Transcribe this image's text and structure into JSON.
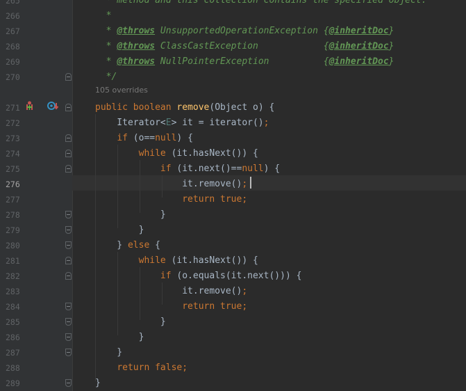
{
  "editor": {
    "lines": [
      {
        "num": "265",
        "tokens": [
          {
            "t": "  * method and this collection contains the specified object.",
            "c": "cmt"
          }
        ]
      },
      {
        "num": "266",
        "tokens": [
          {
            "t": "  *",
            "c": "cmt"
          }
        ]
      },
      {
        "num": "267",
        "tokens": [
          {
            "t": "  * ",
            "c": "cmt"
          },
          {
            "t": "@throws",
            "c": "tag"
          },
          {
            "t": " UnsupportedOperationException ",
            "c": "cmt"
          },
          {
            "t": "{",
            "c": "brace"
          },
          {
            "t": "@inheritDoc",
            "c": "inherit"
          },
          {
            "t": "}",
            "c": "brace"
          }
        ]
      },
      {
        "num": "268",
        "tokens": [
          {
            "t": "  * ",
            "c": "cmt"
          },
          {
            "t": "@throws",
            "c": "tag"
          },
          {
            "t": " ClassCastException            ",
            "c": "cmt"
          },
          {
            "t": "{",
            "c": "brace"
          },
          {
            "t": "@inheritDoc",
            "c": "inherit"
          },
          {
            "t": "}",
            "c": "brace"
          }
        ]
      },
      {
        "num": "269",
        "tokens": [
          {
            "t": "  * ",
            "c": "cmt"
          },
          {
            "t": "@throws",
            "c": "tag"
          },
          {
            "t": " NullPointerException          ",
            "c": "cmt"
          },
          {
            "t": "{",
            "c": "brace"
          },
          {
            "t": "@inheritDoc",
            "c": "inherit"
          },
          {
            "t": "}",
            "c": "brace"
          }
        ]
      },
      {
        "num": "270",
        "tokens": [
          {
            "t": "  */",
            "c": "cmt"
          }
        ]
      },
      {
        "num": "",
        "tokens": []
      },
      {
        "num": "271",
        "tokens": [
          {
            "t": "public boolean ",
            "c": "kw"
          },
          {
            "t": "remove",
            "c": "fn"
          },
          {
            "t": "(Object o) {",
            "c": ""
          }
        ]
      },
      {
        "num": "272",
        "tokens": [
          {
            "t": "    Iterator<",
            "c": ""
          },
          {
            "t": "E",
            "c": "generic"
          },
          {
            "t": "> it = iterator()",
            "c": ""
          },
          {
            "t": ";",
            "c": "kw"
          }
        ]
      },
      {
        "num": "273",
        "tokens": [
          {
            "t": "    ",
            "c": ""
          },
          {
            "t": "if",
            "c": "kw"
          },
          {
            "t": " (o==",
            "c": ""
          },
          {
            "t": "null",
            "c": "kw"
          },
          {
            "t": ") {",
            "c": ""
          }
        ]
      },
      {
        "num": "274",
        "tokens": [
          {
            "t": "        ",
            "c": ""
          },
          {
            "t": "while",
            "c": "kw"
          },
          {
            "t": " (it.hasNext()) {",
            "c": ""
          }
        ]
      },
      {
        "num": "275",
        "tokens": [
          {
            "t": "            ",
            "c": ""
          },
          {
            "t": "if",
            "c": "kw"
          },
          {
            "t": " (it.next()==",
            "c": ""
          },
          {
            "t": "null",
            "c": "kw"
          },
          {
            "t": ") {",
            "c": ""
          }
        ]
      },
      {
        "num": "276",
        "tokens": [
          {
            "t": "                it.remove()",
            "c": ""
          },
          {
            "t": ";",
            "c": "kw"
          }
        ]
      },
      {
        "num": "277",
        "tokens": [
          {
            "t": "                ",
            "c": ""
          },
          {
            "t": "return true;",
            "c": "kw"
          }
        ]
      },
      {
        "num": "278",
        "tokens": [
          {
            "t": "            }",
            "c": ""
          }
        ]
      },
      {
        "num": "279",
        "tokens": [
          {
            "t": "        }",
            "c": ""
          }
        ]
      },
      {
        "num": "280",
        "tokens": [
          {
            "t": "    } ",
            "c": ""
          },
          {
            "t": "else",
            "c": "kw"
          },
          {
            "t": " {",
            "c": ""
          }
        ]
      },
      {
        "num": "281",
        "tokens": [
          {
            "t": "        ",
            "c": ""
          },
          {
            "t": "while",
            "c": "kw"
          },
          {
            "t": " (it.hasNext()) {",
            "c": ""
          }
        ]
      },
      {
        "num": "282",
        "tokens": [
          {
            "t": "            ",
            "c": ""
          },
          {
            "t": "if",
            "c": "kw"
          },
          {
            "t": " (o.equals(it.next())) {",
            "c": ""
          }
        ]
      },
      {
        "num": "283",
        "tokens": [
          {
            "t": "                it.remove()",
            "c": ""
          },
          {
            "t": ";",
            "c": "kw"
          }
        ]
      },
      {
        "num": "284",
        "tokens": [
          {
            "t": "                ",
            "c": ""
          },
          {
            "t": "return true;",
            "c": "kw"
          }
        ]
      },
      {
        "num": "285",
        "tokens": [
          {
            "t": "            }",
            "c": ""
          }
        ]
      },
      {
        "num": "286",
        "tokens": [
          {
            "t": "        }",
            "c": ""
          }
        ]
      },
      {
        "num": "287",
        "tokens": [
          {
            "t": "    }",
            "c": ""
          }
        ]
      },
      {
        "num": "288",
        "tokens": [
          {
            "t": "    ",
            "c": ""
          },
          {
            "t": "return false;",
            "c": "kw"
          }
        ]
      },
      {
        "num": "289",
        "tokens": [
          {
            "t": "}",
            "c": ""
          }
        ]
      }
    ],
    "overrides_hint": "105 overrides",
    "current_line": "276",
    "colors": {
      "background": "#2b2b2b",
      "gutter": "#313335",
      "keyword": "#cc7832",
      "method": "#ffc66d",
      "comment": "#629755",
      "text": "#a9b7c6"
    },
    "gutter_icons": {
      "implements": "implements-icon",
      "overrides": "overrides-icon"
    }
  }
}
